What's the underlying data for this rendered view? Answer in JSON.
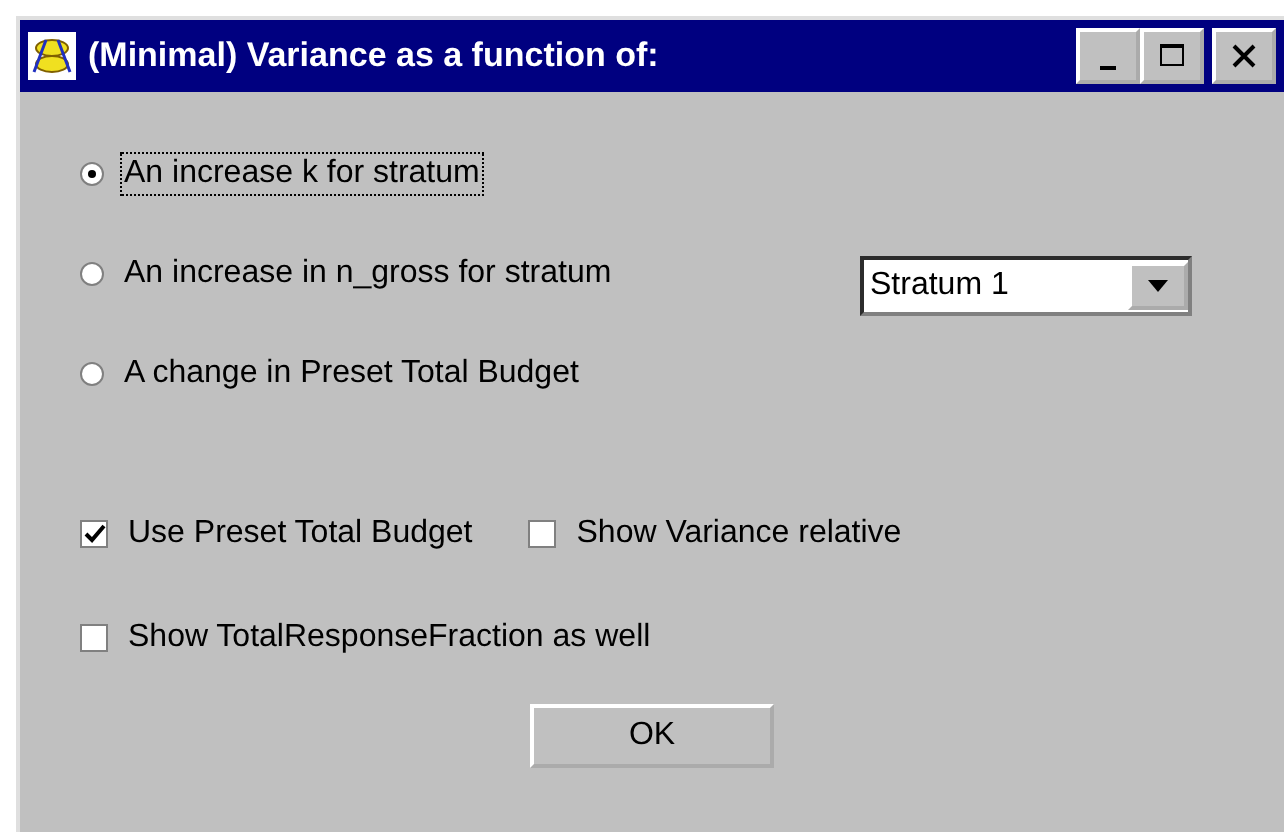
{
  "window": {
    "title": "(Minimal) Variance as a function of:"
  },
  "options": [
    {
      "label": "An increase k for stratum",
      "selected": true,
      "focused": true
    },
    {
      "label": "An increase in n_gross for stratum",
      "selected": false,
      "focused": false
    },
    {
      "label": "A change in Preset Total Budget",
      "selected": false,
      "focused": false
    }
  ],
  "stratum_dropdown": {
    "value": "Stratum 1"
  },
  "checkbox_rows": [
    [
      {
        "label": "Use Preset Total Budget",
        "checked": true
      },
      {
        "label": "Show Variance relative",
        "checked": false
      }
    ],
    [
      {
        "label": "Show TotalResponseFraction as well",
        "checked": false
      }
    ]
  ],
  "buttons": [
    {
      "label": "OK"
    }
  ]
}
